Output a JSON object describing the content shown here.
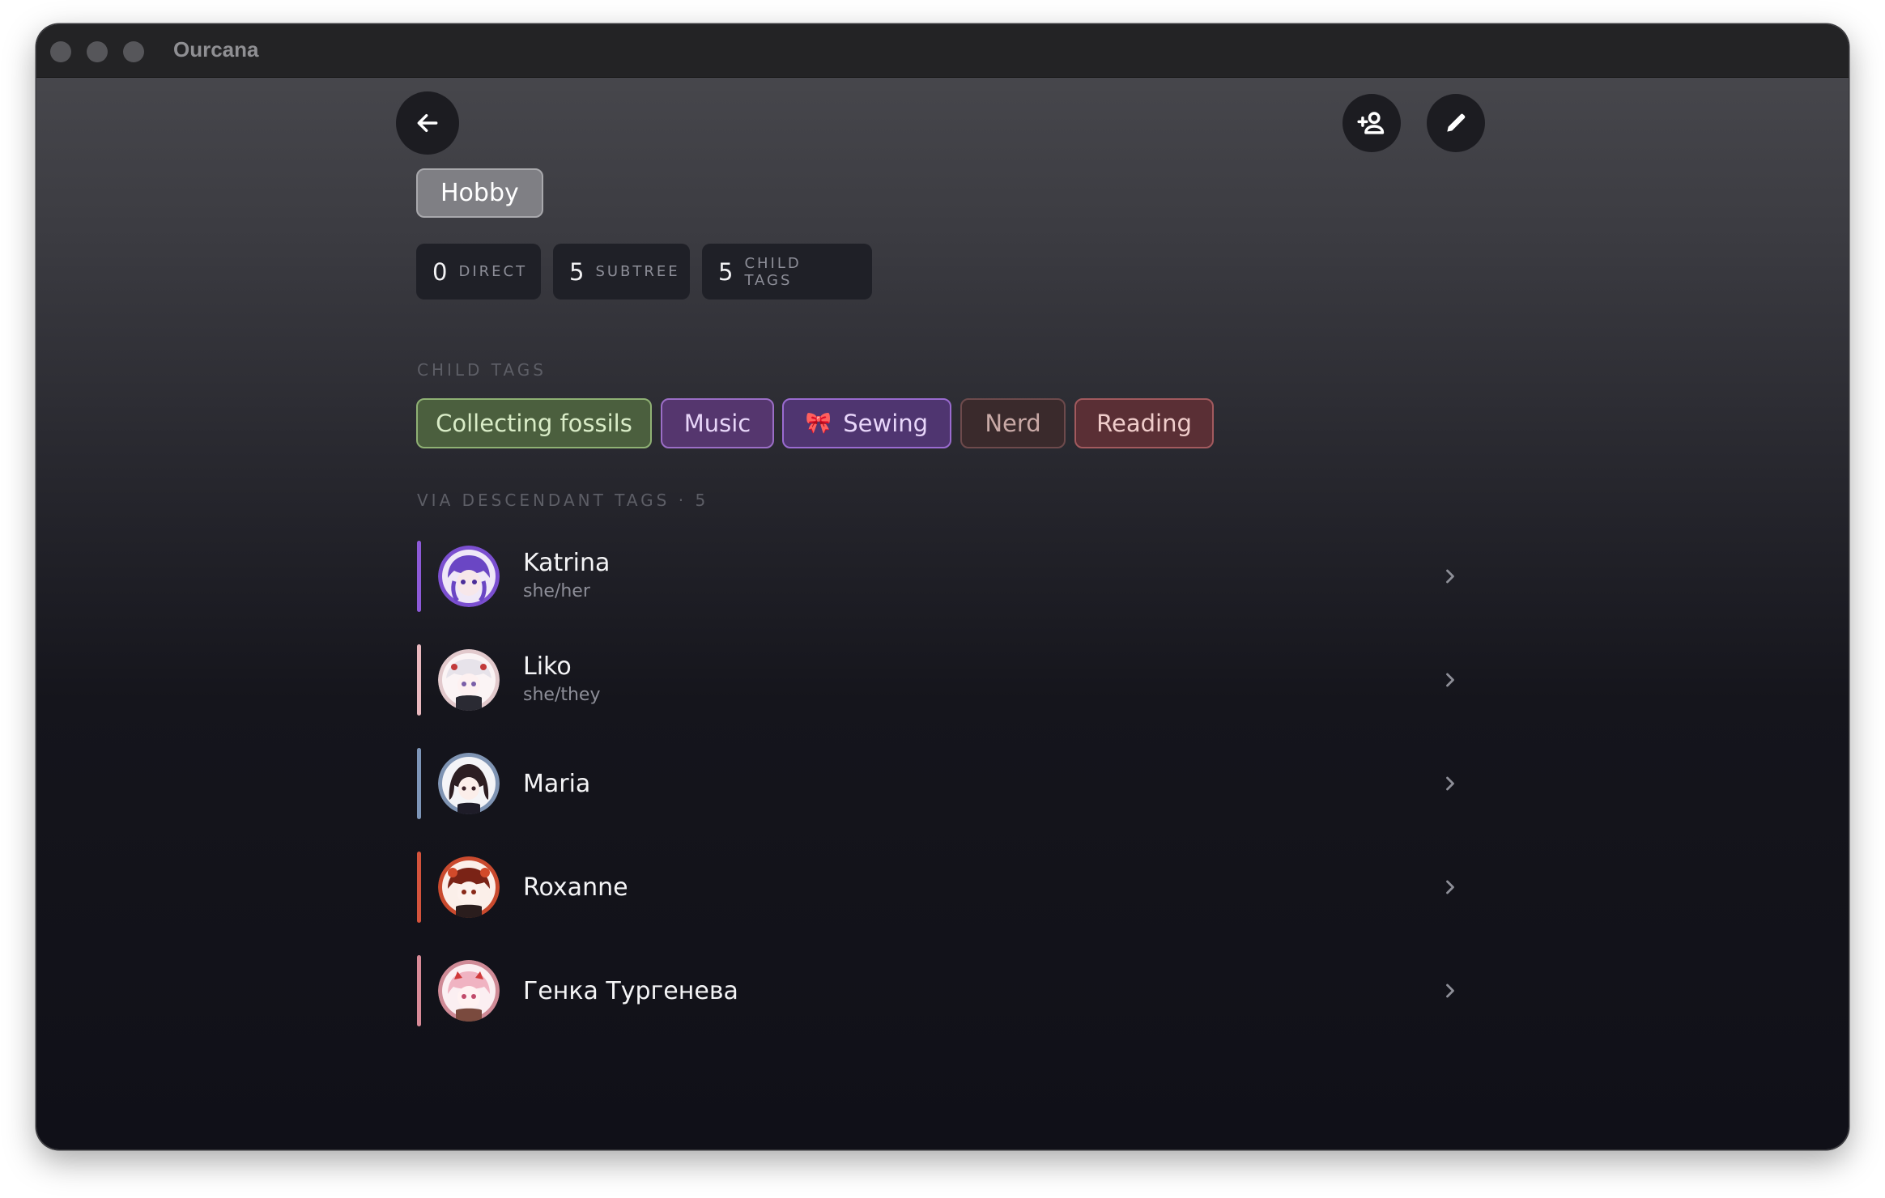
{
  "window": {
    "title": "Ourcana"
  },
  "toolbar": {
    "back_icon": "arrow-left-icon",
    "add_member_icon": "person-add-icon",
    "edit_icon": "pencil-icon"
  },
  "tag": {
    "name": "Hobby"
  },
  "stats": [
    {
      "value": "0",
      "label": "DIRECT"
    },
    {
      "value": "5",
      "label": "SUBTREE"
    },
    {
      "value": "5",
      "label": "CHILD TAGS"
    }
  ],
  "child_tags_section": {
    "label": "CHILD TAGS"
  },
  "child_tags": [
    {
      "label": "Collecting fossils",
      "emoji": "",
      "bg": "#4b5f3e",
      "border": "#8fb174",
      "color": "#d9ecc7"
    },
    {
      "label": "Music",
      "emoji": "",
      "bg": "#55366e",
      "border": "#9b6ec6",
      "color": "#e7d5f8"
    },
    {
      "label": "Sewing",
      "emoji": "🎀",
      "bg": "#4f3570",
      "border": "#9a6bd0",
      "color": "#e8d6fa"
    },
    {
      "label": "Nerd",
      "emoji": "",
      "bg": "#3a2a2c",
      "border": "#6d4a4c",
      "color": "#c8a9a6"
    },
    {
      "label": "Reading",
      "emoji": "",
      "bg": "#5a2f35",
      "border": "#a25a5e",
      "color": "#f0cdcb"
    }
  ],
  "descendants_section": {
    "label": "VIA DESCENDANT TAGS · 5"
  },
  "members": [
    {
      "name": "Katrina",
      "pronouns": "she/her",
      "accent": "#8d5ad8"
    },
    {
      "name": "Liko",
      "pronouns": "she/they",
      "accent": "#e9b8be"
    },
    {
      "name": "Maria",
      "pronouns": "",
      "accent": "#7d95b8"
    },
    {
      "name": "Roxanne",
      "pronouns": "",
      "accent": "#d4533c"
    },
    {
      "name": "Генка Тургенева",
      "pronouns": "",
      "accent": "#d88a97"
    }
  ]
}
